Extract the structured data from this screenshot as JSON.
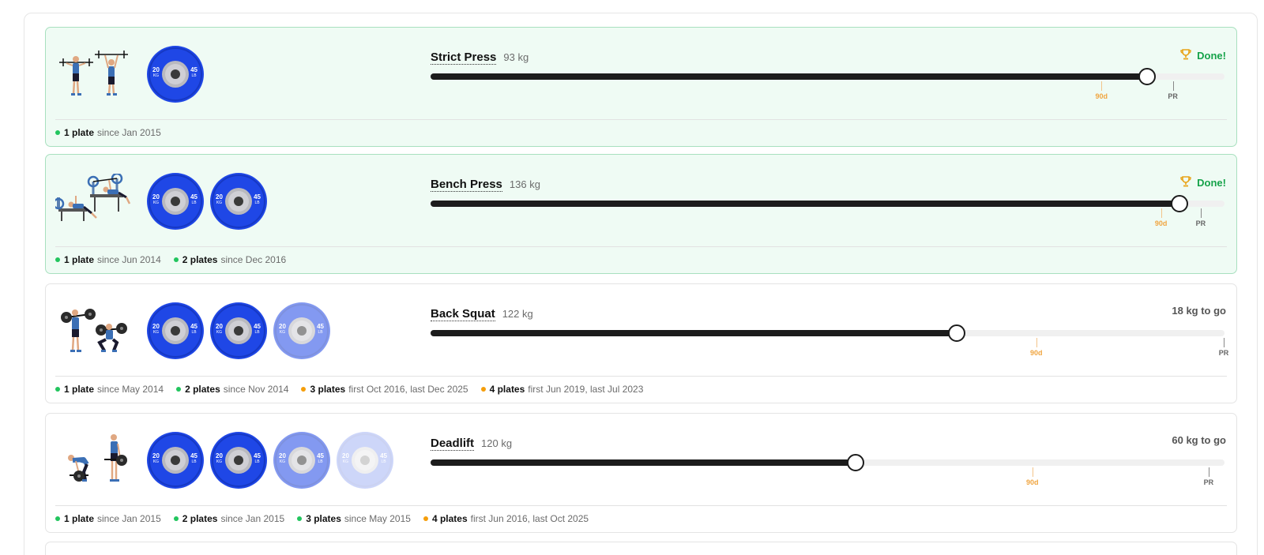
{
  "lifts": [
    {
      "name": "Strict Press",
      "weight": "93 kg",
      "status": "Done!",
      "status_kind": "done",
      "progress": 0.902,
      "mark_90d": 0.845,
      "mark_pr": 0.935,
      "plate_count": 1,
      "history": [
        {
          "label": "1 plate",
          "text": "since Jan 2015",
          "color": "green"
        }
      ]
    },
    {
      "name": "Bench Press",
      "weight": "136 kg",
      "status": "Done!",
      "status_kind": "done",
      "progress": 0.943,
      "mark_90d": 0.92,
      "mark_pr": 0.97,
      "plate_count": 2,
      "history": [
        {
          "label": "1 plate",
          "text": "since Jun 2014",
          "color": "green"
        },
        {
          "label": "2 plates",
          "text": "since Dec 2016",
          "color": "green"
        }
      ]
    },
    {
      "name": "Back Squat",
      "weight": "122 kg",
      "status": "18 kg to go",
      "status_kind": "todo",
      "progress": 0.663,
      "mark_90d": 0.763,
      "mark_pr": 1.0,
      "plate_count": 3,
      "history": [
        {
          "label": "1 plate",
          "text": "since May 2014",
          "color": "green"
        },
        {
          "label": "2 plates",
          "text": "since Nov 2014",
          "color": "green"
        },
        {
          "label": "3 plates",
          "text": "first Oct 2016, last Dec 2025",
          "color": "amber"
        },
        {
          "label": "4 plates",
          "text": "first Jun 2019, last Jul 2023",
          "color": "amber"
        }
      ]
    },
    {
      "name": "Deadlift",
      "weight": "120 kg",
      "status": "60 kg to go",
      "status_kind": "todo",
      "progress": 0.535,
      "mark_90d": 0.758,
      "mark_pr": 0.98,
      "plate_count": 4,
      "history": [
        {
          "label": "1 plate",
          "text": "since Jan 2015",
          "color": "green"
        },
        {
          "label": "2 plates",
          "text": "since Jan 2015",
          "color": "green"
        },
        {
          "label": "3 plates",
          "text": "since May 2015",
          "color": "green"
        },
        {
          "label": "4 plates",
          "text": "first Jun 2016, last Oct 2025",
          "color": "amber"
        }
      ]
    }
  ],
  "marks": {
    "d90": "90d",
    "pr": "PR"
  },
  "plate_labels": {
    "kg_value": "20",
    "kg_unit": "KG",
    "lb_value": "45",
    "lb_unit": "LB"
  },
  "colors": {
    "plate_blue": "#1f47e6",
    "done_bg": "#effbf4",
    "done_text": "#16a34a",
    "trophy": "#e8a317",
    "bar": "#1c1c1c",
    "mark_90d": "#f0a540"
  },
  "icons": {
    "done": "trophy-icon",
    "strict_press": "overhead-press-figure-icon",
    "bench_press": "bench-press-figure-icon",
    "back_squat": "back-squat-figure-icon",
    "deadlift": "deadlift-figure-icon"
  }
}
